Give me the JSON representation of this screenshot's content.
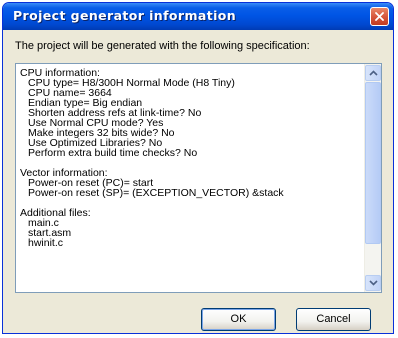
{
  "window": {
    "title": "Project generator information"
  },
  "intro_text": "The project will be generated with the following specification:",
  "spec_lines": [
    {
      "text": "CPU information:",
      "indent": 0
    },
    {
      "text": "CPU type= H8/300H Normal Mode (H8 Tiny)",
      "indent": 1
    },
    {
      "text": "CPU name= 3664",
      "indent": 1
    },
    {
      "text": "Endian type= Big endian",
      "indent": 1
    },
    {
      "text": "Shorten address refs at link-time? No",
      "indent": 1
    },
    {
      "text": "Use Normal CPU mode? Yes",
      "indent": 1
    },
    {
      "text": "Make integers 32 bits wide? No",
      "indent": 1
    },
    {
      "text": "Use Optimized Libraries? No",
      "indent": 1
    },
    {
      "text": "Perform extra build time checks? No",
      "indent": 1
    },
    {
      "text": "",
      "indent": 0
    },
    {
      "text": "Vector information:",
      "indent": 0
    },
    {
      "text": "Power-on reset (PC)= start",
      "indent": 1
    },
    {
      "text": "Power-on reset (SP)= (EXCEPTION_VECTOR) &stack",
      "indent": 1
    },
    {
      "text": "",
      "indent": 0
    },
    {
      "text": "Additional files:",
      "indent": 0
    },
    {
      "text": "main.c",
      "indent": 1
    },
    {
      "text": "start.asm",
      "indent": 1
    },
    {
      "text": "hwinit.c",
      "indent": 1
    }
  ],
  "buttons": {
    "ok": "OK",
    "cancel": "Cancel"
  },
  "icons": {
    "close": "close-icon",
    "scroll_up": "chevron-up-icon",
    "scroll_down": "chevron-down-icon"
  },
  "colors": {
    "titlebar": "#0055e5",
    "close_button": "#d5553a",
    "dialog_background": "#ece9d8"
  }
}
